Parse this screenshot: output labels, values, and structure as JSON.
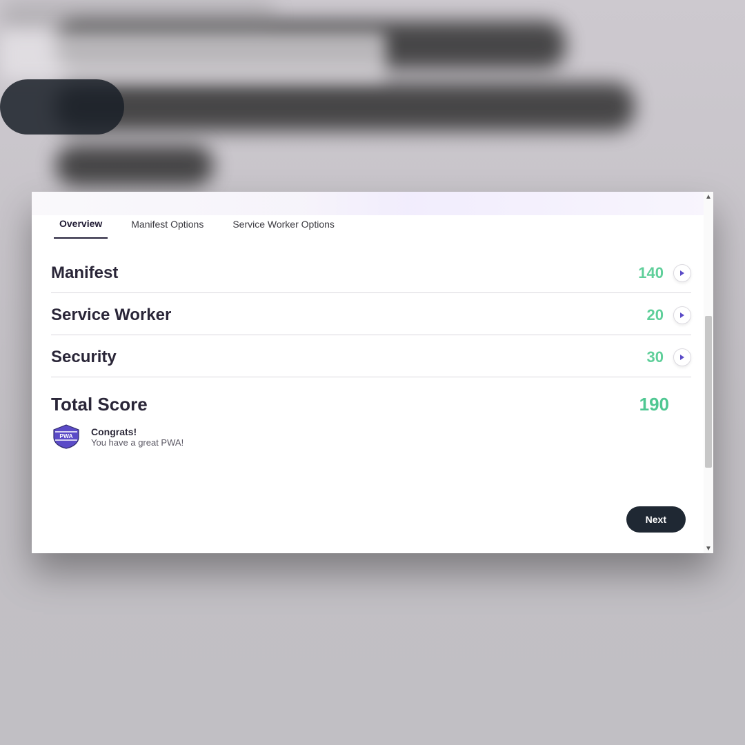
{
  "tabs": {
    "overview": "Overview",
    "manifest_options": "Manifest Options",
    "sw_options": "Service Worker Options"
  },
  "rows": {
    "manifest": {
      "label": "Manifest",
      "score": "140"
    },
    "service_worker": {
      "label": "Service Worker",
      "score": "20"
    },
    "security": {
      "label": "Security",
      "score": "30"
    }
  },
  "total": {
    "label": "Total Score",
    "score": "190"
  },
  "congrats": {
    "title": "Congrats!",
    "subtitle": "You have a great PWA!",
    "badge_text": "PWA"
  },
  "footer": {
    "next": "Next"
  },
  "colors": {
    "accent_green": "#5fcf9a",
    "accent_purple": "#5b4bc7",
    "button_dark": "#1f2833"
  }
}
